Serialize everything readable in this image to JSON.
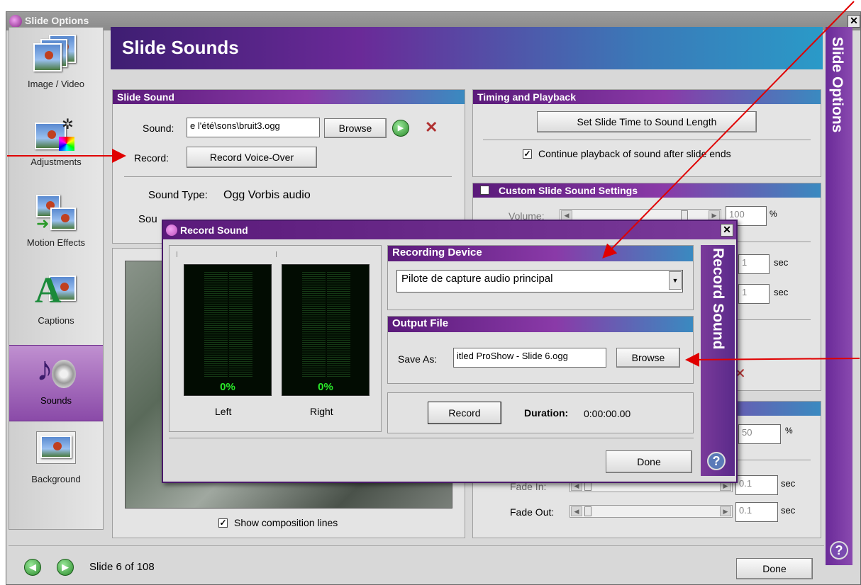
{
  "window": {
    "title": "Slide Options"
  },
  "sidebar": {
    "items": [
      {
        "label": "Image / Video",
        "icon": "image-video-icon",
        "active": false
      },
      {
        "label": "Adjustments",
        "icon": "adjustments-icon",
        "active": false
      },
      {
        "label": "Motion Effects",
        "icon": "motion-effects-icon",
        "active": false
      },
      {
        "label": "Captions",
        "icon": "captions-icon",
        "active": false
      },
      {
        "label": "Sounds",
        "icon": "sounds-icon",
        "active": true
      },
      {
        "label": "Background",
        "icon": "background-icon",
        "active": false
      }
    ]
  },
  "header": {
    "title": "Slide Sounds"
  },
  "side_title": "Slide Options",
  "slide_sound": {
    "heading": "Slide Sound",
    "sound_label": "Sound:",
    "sound_value": "e l'été\\sons\\bruit3.ogg",
    "browse_label": "Browse",
    "record_label": "Record:",
    "record_button": "Record Voice-Over",
    "sound_type_label": "Sound Type:",
    "sound_type_value": "Ogg Vorbis audio",
    "sound_length_fragment": "Sou"
  },
  "timing": {
    "heading": "Timing and Playback",
    "set_time_button": "Set Slide Time to Sound Length",
    "continue_label": "Continue playback of sound after slide ends",
    "continue_checked": true
  },
  "custom": {
    "heading": "Custom Slide Sound Settings",
    "checked": false,
    "volume_label": "Volume:",
    "volume_value": "100",
    "volume_unit": "%",
    "fade_in_value": "1",
    "fade_out_value": "1",
    "sec_unit": "sec"
  },
  "soundtrack": {
    "volume_value": "50",
    "volume_unit": "%",
    "fade_in_label": "Fade In:",
    "fade_in_value": "0.1",
    "fade_out_label": "Fade Out:",
    "fade_out_value": "0.1",
    "sec_unit": "sec"
  },
  "preview": {
    "show_lines_label": "Show composition lines",
    "show_lines_checked": true
  },
  "footer": {
    "slide_counter": "Slide 6 of 108",
    "done_label": "Done"
  },
  "record_dialog": {
    "title": "Record Sound",
    "side_title": "Record Sound",
    "left_pct": "0%",
    "right_pct": "0%",
    "left_label": "Left",
    "right_label": "Right",
    "device_heading": "Recording Device",
    "device_value": "Pilote de capture audio principal",
    "output_heading": "Output File",
    "save_as_label": "Save As:",
    "save_as_value": "itled ProShow - Slide 6.ogg",
    "browse_label": "Browse",
    "record_button": "Record",
    "duration_label": "Duration:",
    "duration_value": "0:00:00.00",
    "done_label": "Done"
  },
  "colors": {
    "accent_purple": "#6a2a98",
    "header_blue": "#2a9ac8",
    "meter_green": "#2ae82a",
    "annotation_red": "#e00000"
  }
}
